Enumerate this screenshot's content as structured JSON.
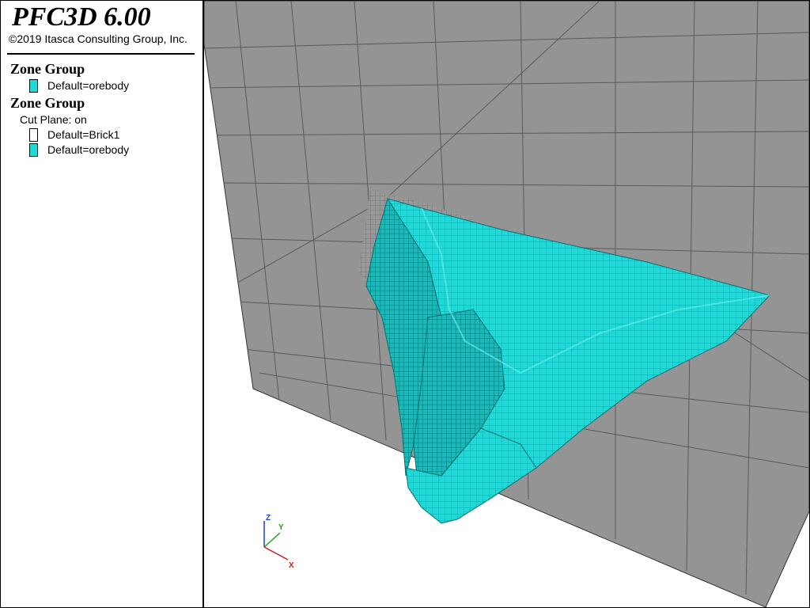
{
  "app": {
    "title": "PFC3D 6.00",
    "copyright": "©2019 Itasca Consulting Group, Inc."
  },
  "legend": {
    "groups": [
      {
        "heading": "Zone Group",
        "subheading": null,
        "items": [
          {
            "label": "Default=orebody",
            "color": "#1fd8d8"
          }
        ]
      },
      {
        "heading": "Zone Group",
        "subheading": "Cut Plane: on",
        "items": [
          {
            "label": "Default=Brick1",
            "color": "#ffffff"
          },
          {
            "label": "Default=orebody",
            "color": "#1fd8d8"
          }
        ]
      }
    ]
  },
  "viewport": {
    "background_color": "#ffffff",
    "mesh_color": "#939393",
    "mesh_line_color": "#555555",
    "orebody_color": "#1fd8d8",
    "orebody_edge_color": "#0a6f6f"
  },
  "axes_triad": {
    "labels": {
      "z": "Z",
      "y": "Y",
      "x": "X"
    },
    "colors": {
      "z": "#1f3fcf",
      "y": "#1fa11f",
      "x": "#cf1f1f"
    }
  }
}
